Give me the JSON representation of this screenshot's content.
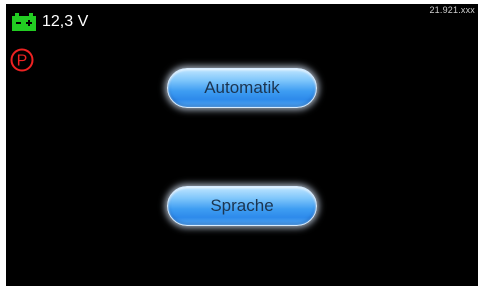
{
  "status_bar": {
    "version": "21.921.xxx",
    "voltage": "12,3 V",
    "battery_icon": "battery-icon",
    "parking_icon": "parking-brake-icon"
  },
  "menu": {
    "automatik_label": "Automatik",
    "sprache_label": "Sprache"
  },
  "colors": {
    "background": "#000000",
    "battery": "#22cc22",
    "parking": "#ee2222",
    "button": "#3e9df2"
  }
}
